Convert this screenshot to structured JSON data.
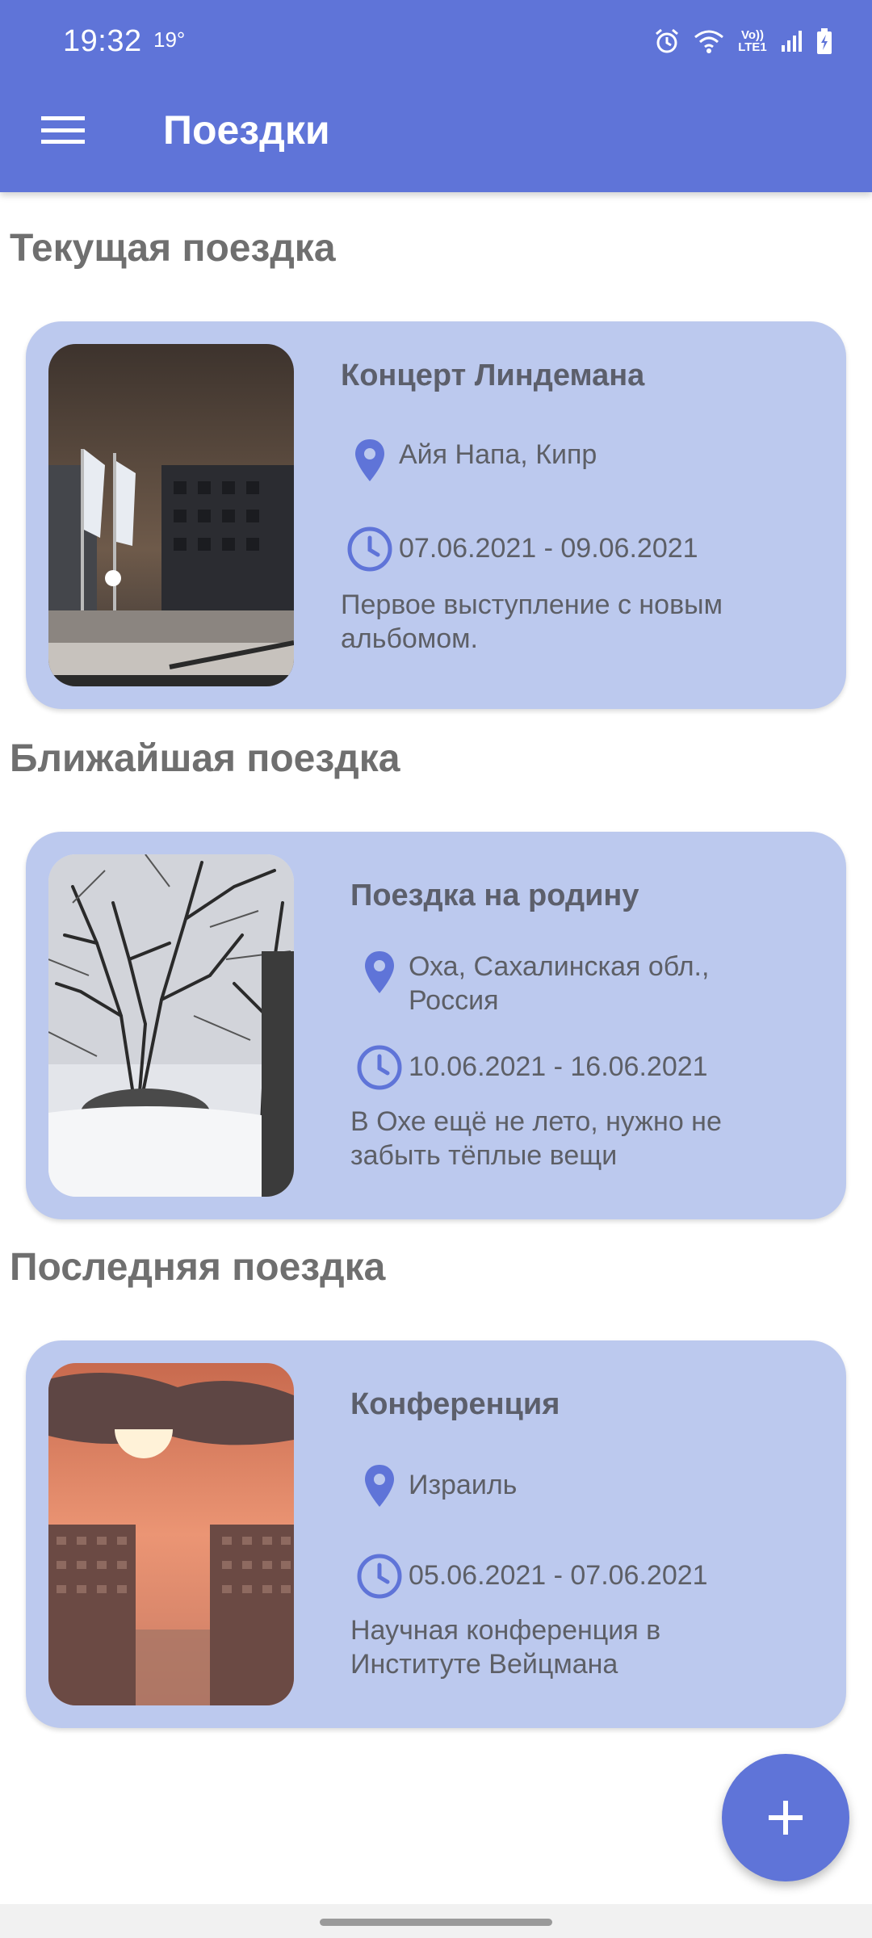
{
  "status": {
    "time": "19:32",
    "temp": "19°",
    "volte": "Vo)) LTE1"
  },
  "app": {
    "title": "Поездки",
    "accent": "#5f74d8",
    "card_color": "#bcc9ee"
  },
  "sections": [
    {
      "title": "Текущая поездка",
      "card": {
        "title": "Концерт Линдемана",
        "location": [
          "Айя Напа, Кипр"
        ],
        "dates": "07.06.2021 - 09.06.2021",
        "description": [
          "Первое выступление с новым",
          "альбомом."
        ],
        "photo": "night-street-photo"
      }
    },
    {
      "title": "Ближайшая поездка",
      "card": {
        "title": "Поездка на родину",
        "location": [
          "Оха, Сахалинская обл.,",
          "Россия"
        ],
        "dates": "10.06.2021 - 16.06.2021",
        "description": [
          "В Охе ещё не лето, нужно не",
          "забыть тёплые вещи"
        ],
        "photo": "snowy-trees-photo"
      }
    },
    {
      "title": "Последняя поездка",
      "card": {
        "title": "Конференция",
        "location": [
          "Израиль"
        ],
        "dates": "05.06.2021 - 07.06.2021",
        "description": [
          "Научная конференция в",
          "Институте Вейцмана"
        ],
        "photo": "sunset-city-photo"
      }
    }
  ],
  "icons": {
    "menu": "menu-icon",
    "location": "location-pin-icon",
    "clock": "clock-icon",
    "add": "plus-icon"
  }
}
